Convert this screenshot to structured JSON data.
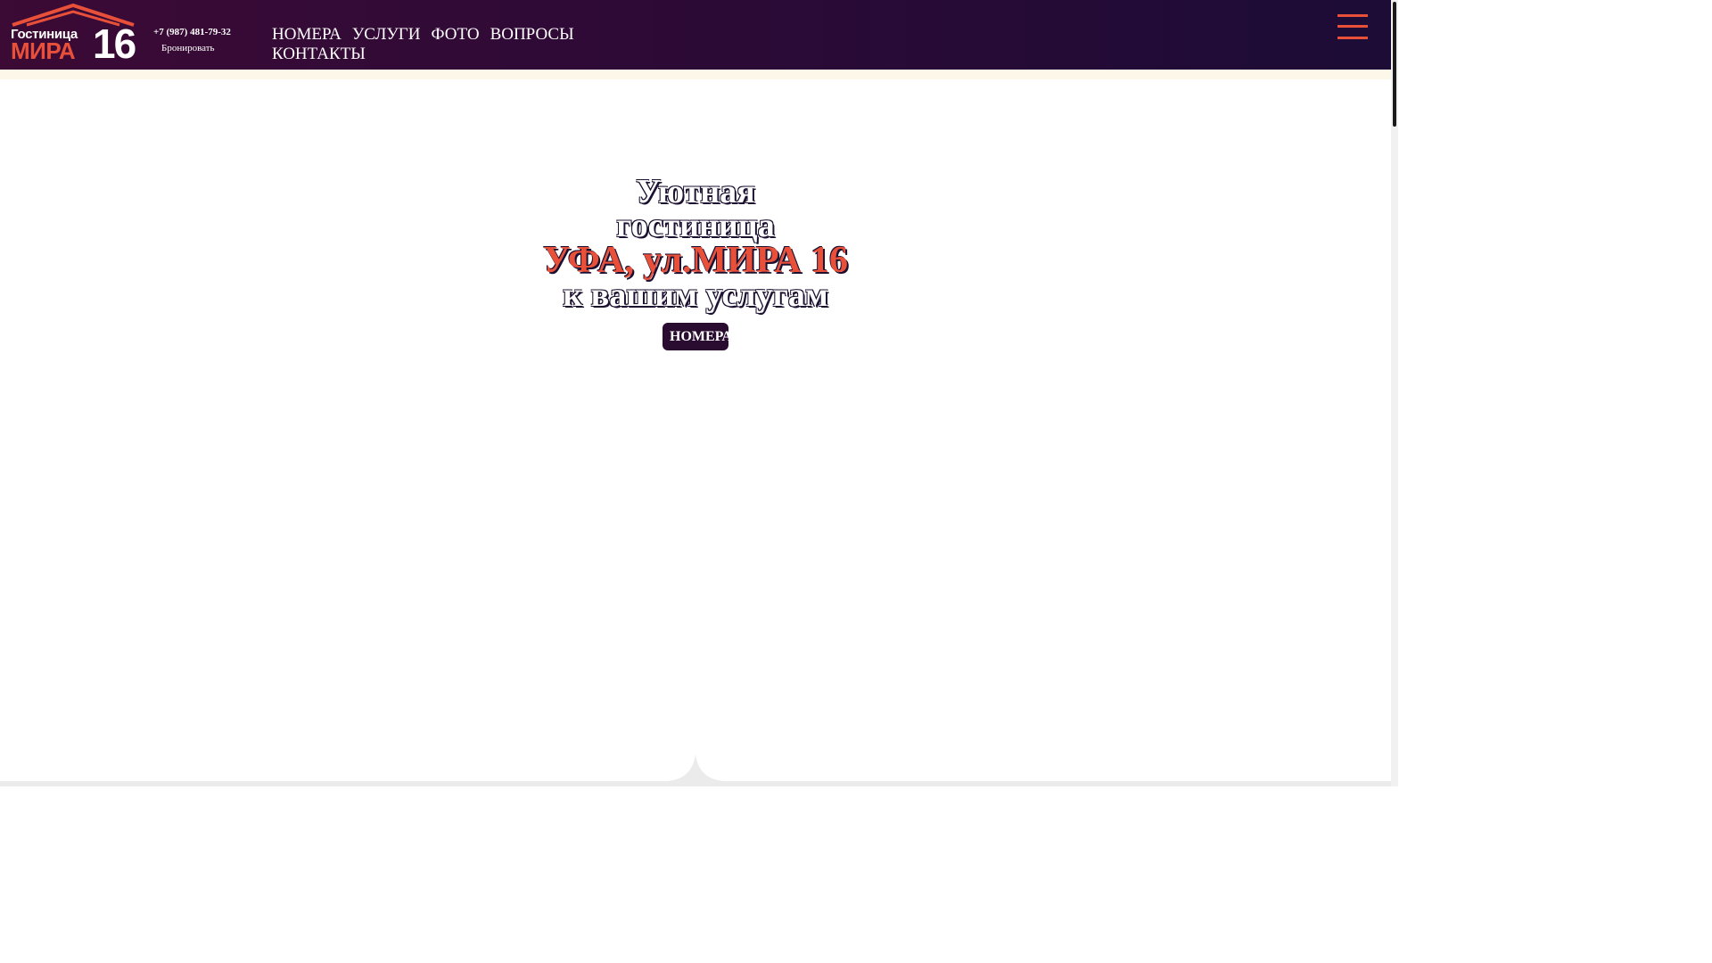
{
  "header": {
    "logo": {
      "line1": "Гостиница",
      "line2": "МИРА",
      "number": "16"
    },
    "phone": "+7 (987) 481-79-32",
    "book_label": "Бронировать",
    "nav": [
      "НОМЕРА",
      "УСЛУГИ",
      "ФОТО",
      "ВОПРОСЫ",
      "КОНТАКТЫ"
    ],
    "menu_icon": "hamburger-icon"
  },
  "hero": {
    "line1": "Уютная",
    "line2": "гостиница",
    "accent": "УФА, ул.МИРА 16",
    "line3": "к вашим услугам",
    "cta_label": "НОМЕРА"
  },
  "colors": {
    "header_dark": "#2e0a36",
    "accent": "#e8503a",
    "strip": "#fdf7ea"
  }
}
